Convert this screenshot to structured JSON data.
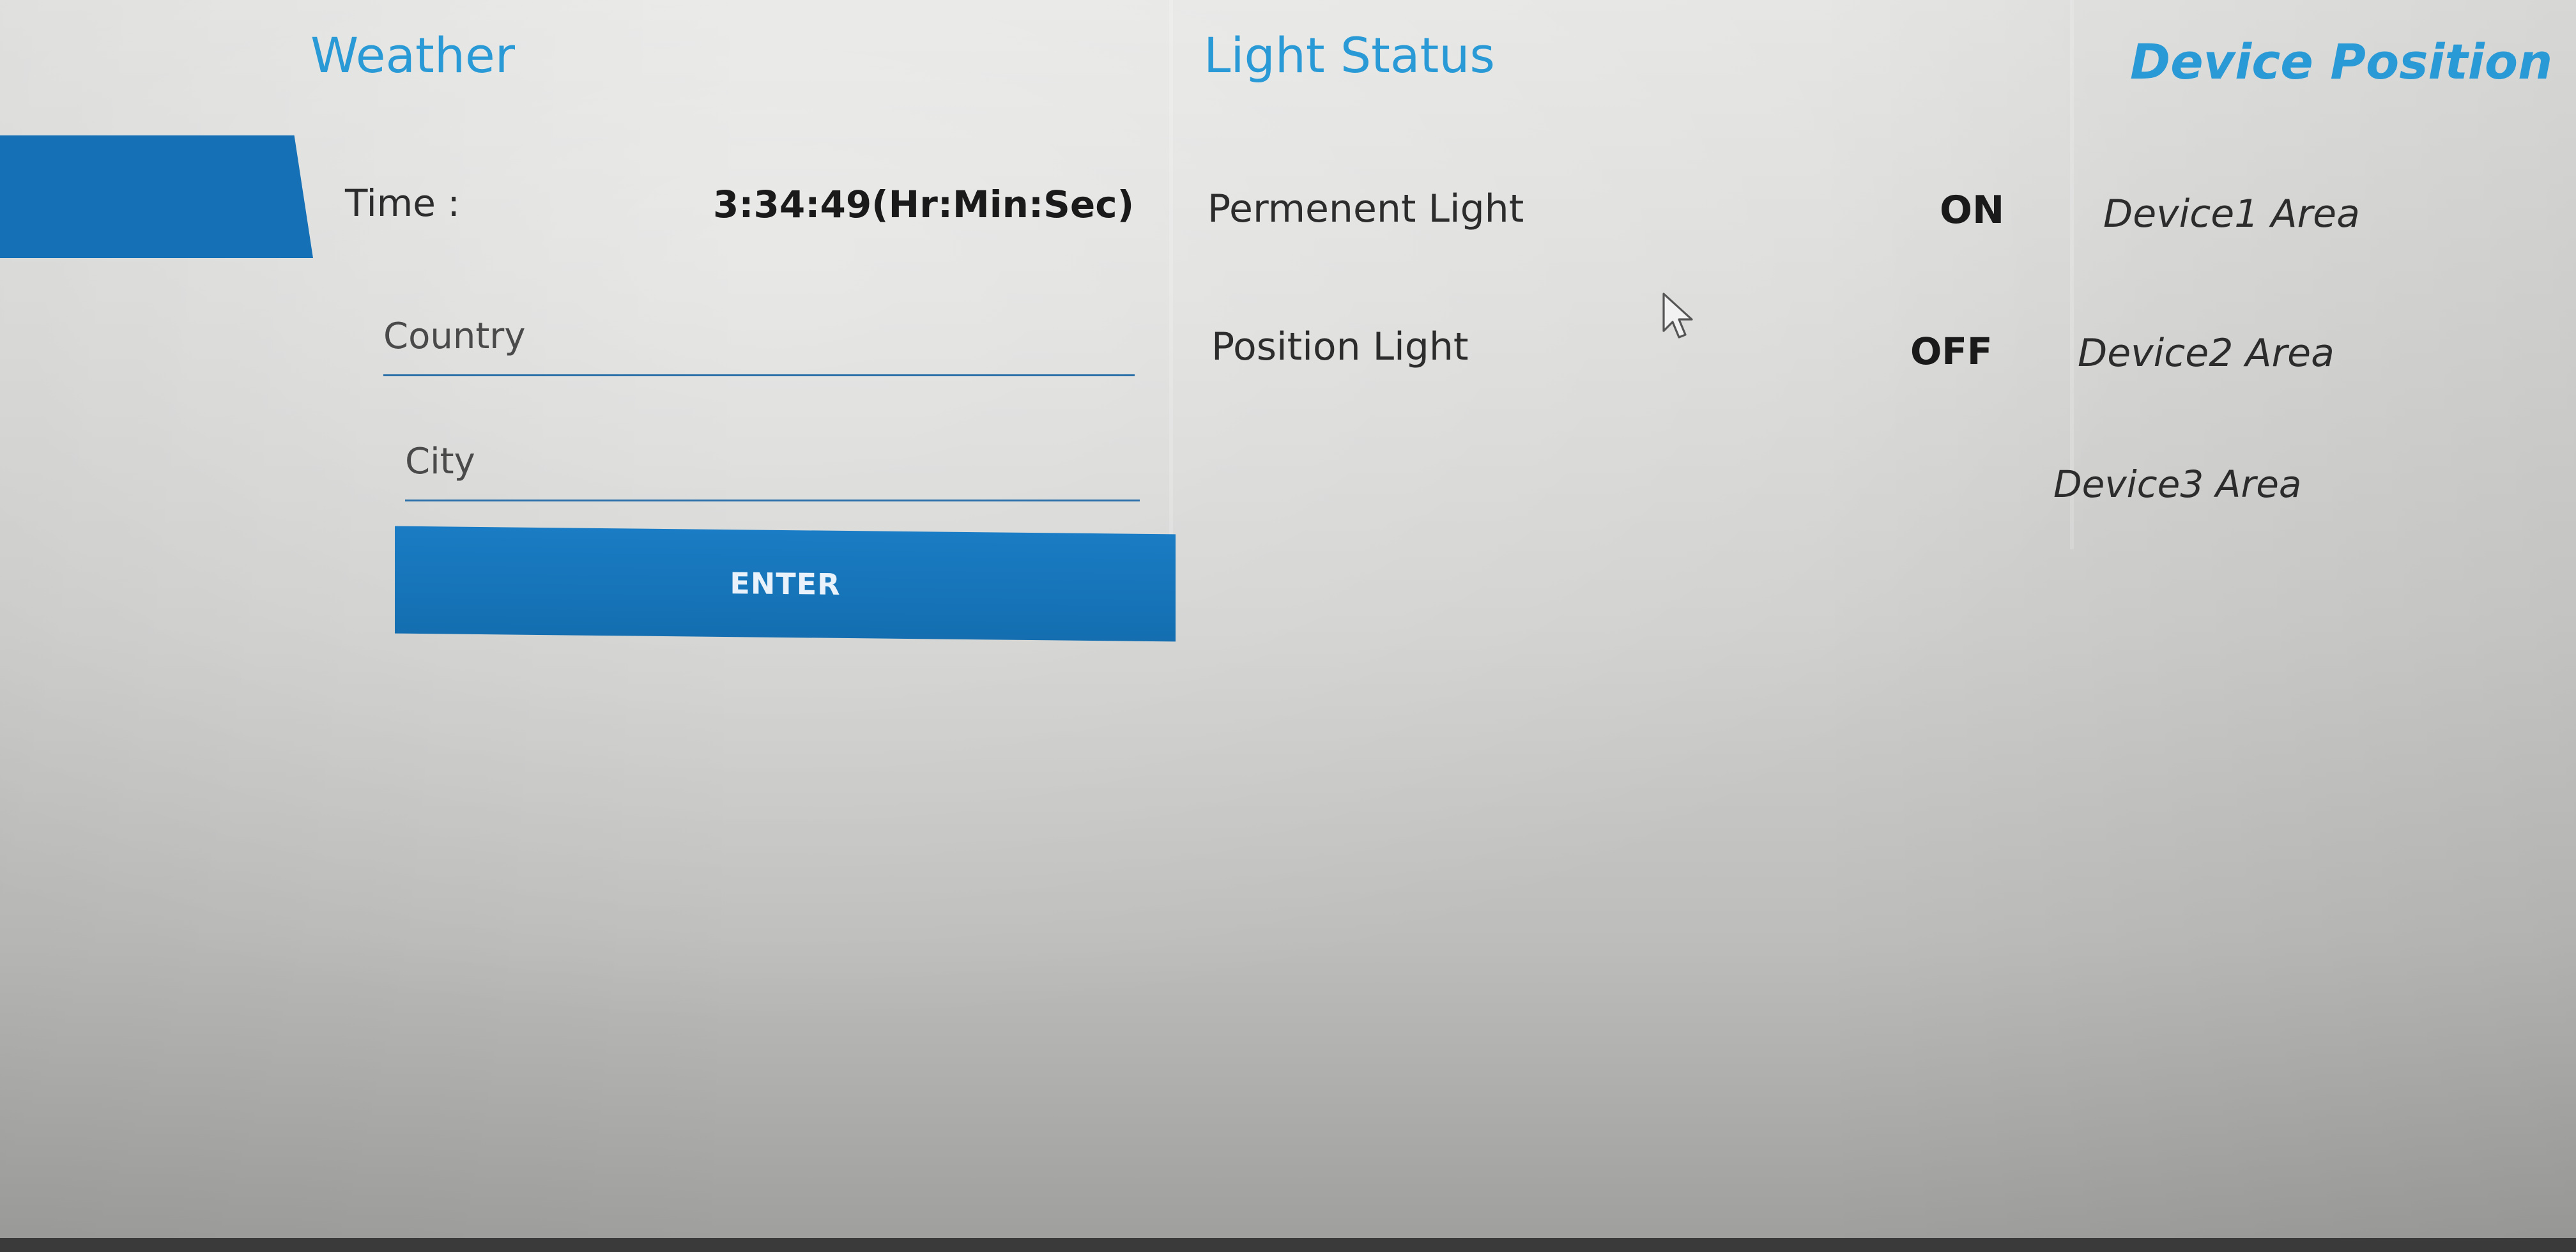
{
  "weather": {
    "heading": "Weather",
    "time_label": "Time :",
    "time_value": "3:34:49(Hr:Min:Sec)",
    "country_placeholder": "Country",
    "city_placeholder": "City",
    "enter_label": "ENTER"
  },
  "light_status": {
    "heading": "Light Status",
    "rows": [
      {
        "label": "Permenent Light",
        "status": "ON"
      },
      {
        "label": "Position Light",
        "status": "OFF"
      }
    ]
  },
  "device_position": {
    "heading": "Device Position",
    "areas": [
      "Device1 Area",
      "Device2 Area",
      "Device3 Area"
    ]
  },
  "colors": {
    "accent": "#2a9ad6",
    "button": "#1670b6"
  },
  "icons": {
    "cursor": "mouse-pointer-icon"
  }
}
